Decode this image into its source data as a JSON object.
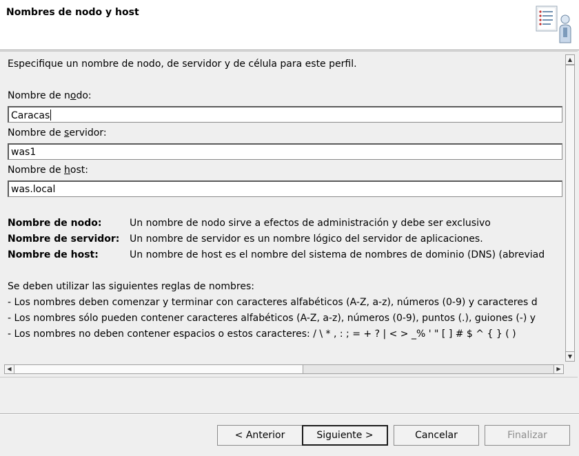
{
  "header": {
    "title": "Nombres de nodo y host",
    "icon": "profile-checklist-user-icon"
  },
  "content": {
    "intro": "Especifique un nombre de nodo, de servidor y de célula para este perfil.",
    "fields": [
      {
        "label_pre": "Nombre de n",
        "label_mnemonic": "o",
        "label_post": "do:",
        "value": "Caracas"
      },
      {
        "label_pre": "Nombre de ",
        "label_mnemonic": "s",
        "label_post": "ervidor:",
        "value": "was1"
      },
      {
        "label_pre": "Nombre de ",
        "label_mnemonic": "h",
        "label_post": "ost:",
        "value": "was.local"
      }
    ],
    "definitions": [
      {
        "term": "Nombre de nodo:",
        "desc": "Un nombre de nodo sirve a efectos de administración y debe ser exclusivo"
      },
      {
        "term": "Nombre de servidor:",
        "desc": "Un nombre de servidor es un nombre lógico del servidor de aplicaciones."
      },
      {
        "term": "Nombre de host:",
        "desc": "Un nombre de host es el nombre del sistema de nombres de dominio (DNS) (abreviad"
      }
    ],
    "rules_title": "Se deben  utilizar las siguientes reglas de nombres:",
    "rules": [
      "- Los nombres deben comenzar y terminar con caracteres alfabéticos (A-Z, a-z), números (0-9) y caracteres d",
      "- Los nombres sólo pueden contener caracteres alfabéticos (A-Z, a-z), números (0-9), puntos (.), guiones (-) y",
      "- Los nombres no deben contener espacios o estos caracteres: / \\ * , : ; = + ? | < > _% ' \" [ ] # $ ^ { } ( )"
    ]
  },
  "scrollbars": {
    "up_arrow": "▲",
    "down_arrow": "▼",
    "left_arrow": "◀",
    "right_arrow": "▶"
  },
  "buttons": {
    "back": "< Anterior",
    "next": "Siguiente >",
    "cancel": "Cancelar",
    "finish": "Finalizar"
  },
  "colors": {
    "header_bg": "#ffffff",
    "panel_bg": "#efefef",
    "disabled_text": "#8c8c8c"
  }
}
